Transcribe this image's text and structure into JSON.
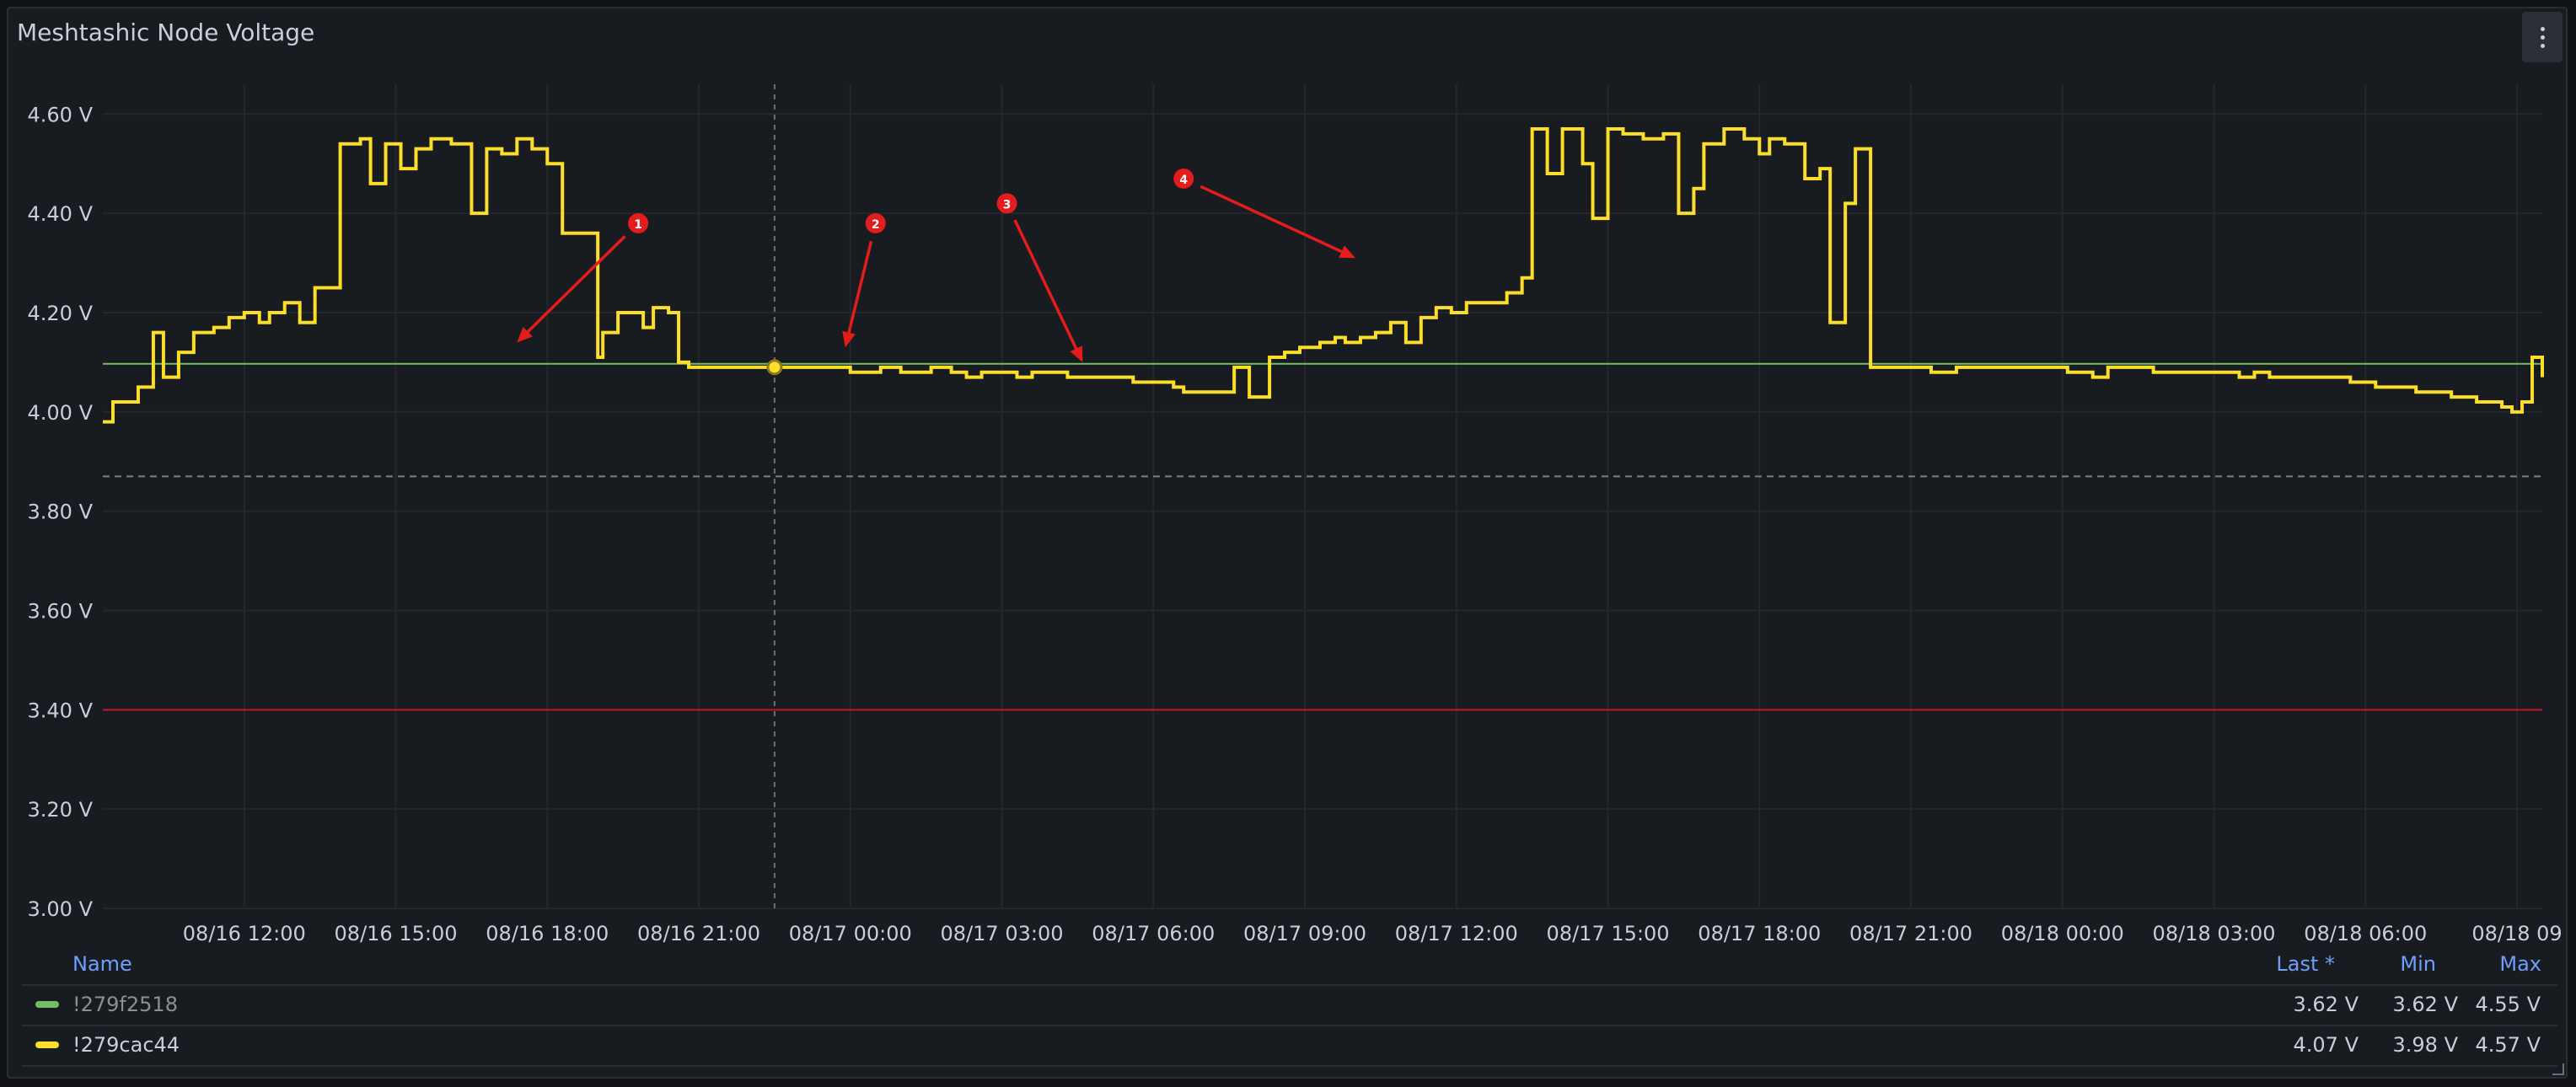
{
  "panel": {
    "title": "Meshtashic Node Voltage"
  },
  "colors": {
    "primary_series": "#fade2a",
    "secondary_series": "#73bf69",
    "threshold_low": "#c4162a",
    "threshold_ok": "#73bf69",
    "annotation": "#e41c1c"
  },
  "chart_data": {
    "type": "line",
    "title": "Meshtashic Node Voltage",
    "xlabel": "",
    "ylabel": "",
    "ylim": [
      3.0,
      4.66
    ],
    "y_ticks": [
      "4.60 V",
      "4.40 V",
      "4.20 V",
      "4.00 V",
      "3.80 V",
      "3.60 V",
      "3.40 V",
      "3.20 V",
      "3.00 V"
    ],
    "y_tick_values": [
      4.6,
      4.4,
      4.2,
      4.0,
      3.8,
      3.6,
      3.4,
      3.2,
      3.0
    ],
    "x_range_hours": [
      -2.8,
      45.5
    ],
    "x_ticks": [
      "08/16 12:00",
      "08/16 15:00",
      "08/16 18:00",
      "08/16 21:00",
      "08/17 00:00",
      "08/17 03:00",
      "08/17 06:00",
      "08/17 09:00",
      "08/17 12:00",
      "08/17 15:00",
      "08/17 18:00",
      "08/17 21:00",
      "08/18 00:00",
      "08/18 03:00",
      "08/18 06:00",
      "08/18 09"
    ],
    "x_tick_hours": [
      0,
      3,
      6,
      9,
      12,
      15,
      18,
      21,
      24,
      27,
      30,
      33,
      36,
      39,
      42,
      45
    ],
    "thresholds": [
      {
        "value": 4.097,
        "color": "#73bf69"
      },
      {
        "value": 3.4,
        "color": "#c4162a"
      },
      {
        "value": 3.87,
        "color": "#7a7d85",
        "dashed": true
      }
    ],
    "crosshair_hour": 10.5,
    "series": [
      {
        "name": "!279cac44",
        "color": "#fade2a",
        "step": true,
        "points": [
          [
            -2.8,
            3.98
          ],
          [
            -2.6,
            4.02
          ],
          [
            -2.1,
            4.05
          ],
          [
            -1.8,
            4.16
          ],
          [
            -1.6,
            4.07
          ],
          [
            -1.3,
            4.12
          ],
          [
            -1.0,
            4.16
          ],
          [
            -0.6,
            4.17
          ],
          [
            -0.3,
            4.19
          ],
          [
            0.0,
            4.2
          ],
          [
            0.3,
            4.18
          ],
          [
            0.5,
            4.2
          ],
          [
            0.8,
            4.22
          ],
          [
            1.1,
            4.18
          ],
          [
            1.4,
            4.25
          ],
          [
            1.9,
            4.54
          ],
          [
            2.3,
            4.55
          ],
          [
            2.5,
            4.46
          ],
          [
            2.8,
            4.54
          ],
          [
            3.1,
            4.49
          ],
          [
            3.4,
            4.53
          ],
          [
            3.7,
            4.55
          ],
          [
            4.1,
            4.54
          ],
          [
            4.5,
            4.4
          ],
          [
            4.8,
            4.53
          ],
          [
            5.1,
            4.52
          ],
          [
            5.4,
            4.55
          ],
          [
            5.7,
            4.53
          ],
          [
            6.0,
            4.5
          ],
          [
            6.3,
            4.36
          ],
          [
            7.0,
            4.11
          ],
          [
            7.1,
            4.16
          ],
          [
            7.4,
            4.2
          ],
          [
            7.8,
            4.2
          ],
          [
            7.9,
            4.17
          ],
          [
            8.1,
            4.21
          ],
          [
            8.4,
            4.2
          ],
          [
            8.6,
            4.1
          ],
          [
            8.8,
            4.09
          ],
          [
            10.5,
            4.09
          ],
          [
            11.0,
            4.09
          ],
          [
            12.0,
            4.08
          ],
          [
            12.6,
            4.09
          ],
          [
            13.0,
            4.08
          ],
          [
            13.6,
            4.09
          ],
          [
            14.0,
            4.08
          ],
          [
            14.3,
            4.07
          ],
          [
            14.6,
            4.08
          ],
          [
            15.3,
            4.07
          ],
          [
            15.6,
            4.08
          ],
          [
            16.3,
            4.07
          ],
          [
            17.0,
            4.07
          ],
          [
            17.6,
            4.06
          ],
          [
            18.2,
            4.06
          ],
          [
            18.4,
            4.05
          ],
          [
            18.6,
            4.04
          ],
          [
            19.4,
            4.04
          ],
          [
            19.6,
            4.09
          ],
          [
            19.9,
            4.03
          ],
          [
            20.3,
            4.11
          ],
          [
            20.6,
            4.12
          ],
          [
            20.9,
            4.13
          ],
          [
            21.3,
            4.14
          ],
          [
            21.6,
            4.15
          ],
          [
            21.8,
            4.14
          ],
          [
            22.1,
            4.15
          ],
          [
            22.4,
            4.16
          ],
          [
            22.7,
            4.18
          ],
          [
            23.0,
            4.14
          ],
          [
            23.3,
            4.19
          ],
          [
            23.6,
            4.21
          ],
          [
            23.9,
            4.2
          ],
          [
            24.2,
            4.22
          ],
          [
            25.0,
            4.24
          ],
          [
            25.3,
            4.27
          ],
          [
            25.5,
            4.57
          ],
          [
            25.8,
            4.48
          ],
          [
            26.1,
            4.57
          ],
          [
            26.5,
            4.5
          ],
          [
            26.7,
            4.39
          ],
          [
            27.0,
            4.57
          ],
          [
            27.3,
            4.56
          ],
          [
            27.7,
            4.55
          ],
          [
            28.1,
            4.56
          ],
          [
            28.4,
            4.4
          ],
          [
            28.7,
            4.45
          ],
          [
            28.9,
            4.54
          ],
          [
            29.3,
            4.57
          ],
          [
            29.7,
            4.55
          ],
          [
            30.0,
            4.52
          ],
          [
            30.2,
            4.55
          ],
          [
            30.5,
            4.54
          ],
          [
            30.9,
            4.47
          ],
          [
            31.2,
            4.49
          ],
          [
            31.4,
            4.18
          ],
          [
            31.7,
            4.42
          ],
          [
            31.9,
            4.53
          ],
          [
            32.2,
            4.09
          ],
          [
            33.4,
            4.08
          ],
          [
            33.9,
            4.09
          ],
          [
            36.1,
            4.08
          ],
          [
            36.6,
            4.07
          ],
          [
            36.9,
            4.09
          ],
          [
            37.8,
            4.08
          ],
          [
            39.5,
            4.07
          ],
          [
            39.8,
            4.08
          ],
          [
            40.1,
            4.07
          ],
          [
            40.4,
            4.07
          ],
          [
            41.7,
            4.06
          ],
          [
            42.2,
            4.05
          ],
          [
            43.0,
            4.04
          ],
          [
            43.7,
            4.03
          ],
          [
            44.2,
            4.02
          ],
          [
            44.7,
            4.01
          ],
          [
            44.9,
            4.0
          ],
          [
            45.1,
            4.02
          ],
          [
            45.3,
            4.11
          ],
          [
            45.5,
            4.07
          ]
        ]
      }
    ],
    "annotations": [
      {
        "label": "1",
        "marker": [
          7.8,
          4.38
        ],
        "arrow_to": [
          5.4,
          4.14
        ]
      },
      {
        "label": "2",
        "marker": [
          12.5,
          4.38
        ],
        "arrow_to": [
          11.9,
          4.13
        ]
      },
      {
        "label": "3",
        "marker": [
          15.1,
          4.42
        ],
        "arrow_to": [
          16.6,
          4.1
        ]
      },
      {
        "label": "4",
        "marker": [
          18.6,
          4.47
        ],
        "arrow_to": [
          22.0,
          4.31
        ]
      }
    ],
    "legend_placement": "bottom"
  },
  "legend": {
    "headers": {
      "name": "Name",
      "last": "Last *",
      "min": "Min",
      "max": "Max"
    },
    "rows": [
      {
        "name": "!279f2518",
        "color": "#73bf69",
        "last": "3.62 V",
        "min": "3.62 V",
        "max": "4.55 V",
        "dimmed": true
      },
      {
        "name": "!279cac44",
        "color": "#fade2a",
        "last": "4.07 V",
        "min": "3.98 V",
        "max": "4.57 V",
        "dimmed": false
      }
    ]
  }
}
